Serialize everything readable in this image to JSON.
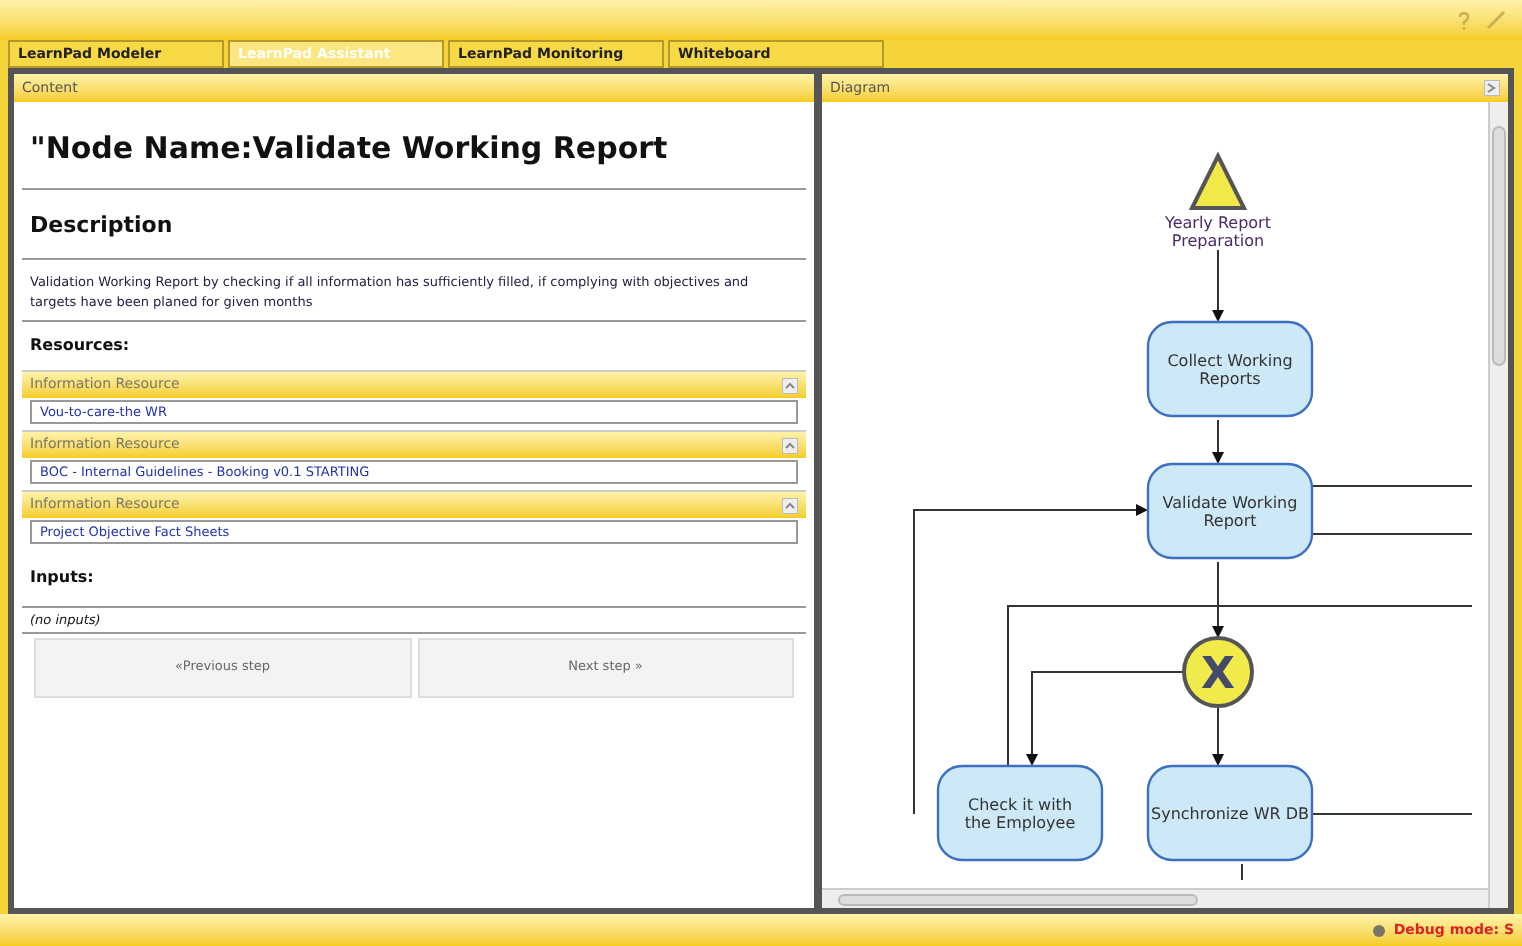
{
  "tabs": [
    {
      "label": "LearnPad Modeler",
      "selected": false
    },
    {
      "label": "LearnPad Assistant",
      "selected": true
    },
    {
      "label": "LearnPad Monitoring",
      "selected": false
    },
    {
      "label": "Whiteboard",
      "selected": false
    }
  ],
  "content": {
    "header": "Content",
    "node_name": "\"Node Name:Validate Working Report",
    "description_heading": "Description",
    "description": "Validation Working Report by checking if all information has sufficiently filled, if complying with objectives and targets have been planed for given months",
    "resources_heading": "Resources:",
    "resources": [
      {
        "title": "Information Resource",
        "value": "Vou-to-care-the WR"
      },
      {
        "title": "Information Resource",
        "value": "BOC - Internal Guidelines - Booking v0.1 STARTING"
      },
      {
        "title": "Information Resource",
        "value": "Project Objective Fact Sheets"
      }
    ],
    "inputs_heading": "Inputs:",
    "inputs_value": "(no inputs)",
    "previous_button": "«Previous step",
    "next_button": "Next step »"
  },
  "diagram": {
    "header": "Diagram",
    "nodes": [
      {
        "kind": "event",
        "label": "Yearly Report Preparation"
      },
      {
        "kind": "task",
        "label": "Collect Working Reports"
      },
      {
        "kind": "task",
        "label": "Validate Working Report"
      },
      {
        "kind": "gateway",
        "label": "X"
      },
      {
        "kind": "task",
        "label": "Check it with the Employee"
      },
      {
        "kind": "task",
        "label": "Synchronize WR DB"
      }
    ]
  },
  "status_bar": {
    "text": "Debug mode: S"
  }
}
